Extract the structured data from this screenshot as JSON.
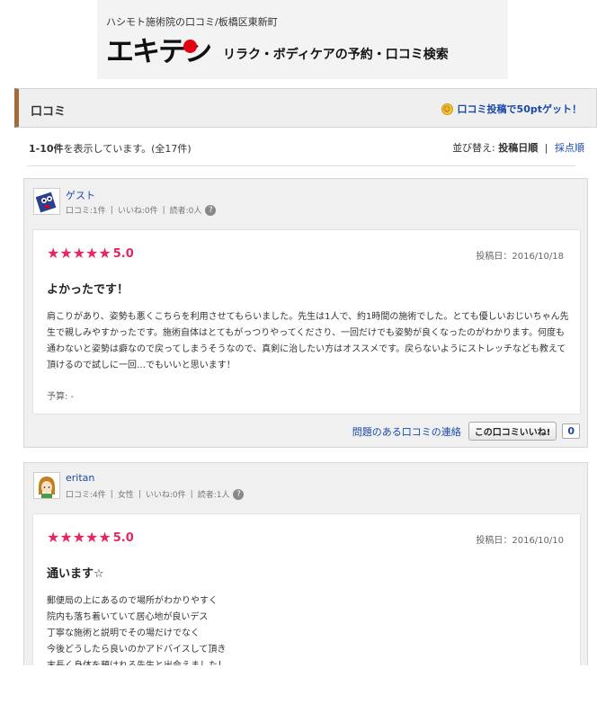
{
  "header": {
    "breadcrumb": "ハシモト施術院の口コミ/板橋区東新町",
    "logo_text": "エキテン",
    "tagline": "リラク・ボディケアの予約・口コミ検索"
  },
  "section": {
    "title": "口コミ",
    "post_link": "口コミ投稿で50ptゲット！"
  },
  "listing": {
    "range": "1-10件",
    "range_suffix": "を表示しています。(全17件)",
    "sort_label": "並び替え:",
    "sort_active": "投稿日順",
    "sort_other": "採点順"
  },
  "reviews": [
    {
      "user": "ゲスト",
      "meta": [
        "口コミ:1件",
        "いいね:0件",
        "読者:0人"
      ],
      "rating": "5.0",
      "stars": 5,
      "date": "投稿日：2016/10/18",
      "title": "よかったです！",
      "body": "肩こりがあり、姿勢も悪くこちらを利用させてもらいました。先生は1人で、約1時間の施術でした。とても優しいおじいちゃん先生で親しみやすかったです。施術自体はとてもがっつりやってくださり、一回だけでも姿勢が良くなったのがわかります。何度も通わないと姿勢は癖なので戻ってしまうそうなので、真剣に治したい方はオススメです。戻らないようにストレッチなども教えて頂けるので試しに一回…でもいいと思います！",
      "budget": "予算: -",
      "report_link": "問題のある口コミの連絡",
      "like_button": "この口コミいいね!",
      "like_count": "0"
    },
    {
      "user": "eritan",
      "meta": [
        "口コミ:4件",
        "女性",
        "いいね:0件",
        "読者:1人"
      ],
      "rating": "5.0",
      "stars": 5,
      "date": "投稿日：2016/10/10",
      "title": "通います☆",
      "body_lines": [
        "郵便局の上にあるので場所がわかりやすく",
        "院内も落ち着いていて居心地が良いデス",
        "丁寧な施術と説明でその場だけでなく",
        "今後どうしたら良いのかアドバイスして頂き",
        "末長く身体を預けれる先生と出会えました！"
      ]
    }
  ],
  "colors": {
    "link": "#1a4aa8",
    "rating": "#e8265e",
    "section_accent": "#a56a3c"
  }
}
